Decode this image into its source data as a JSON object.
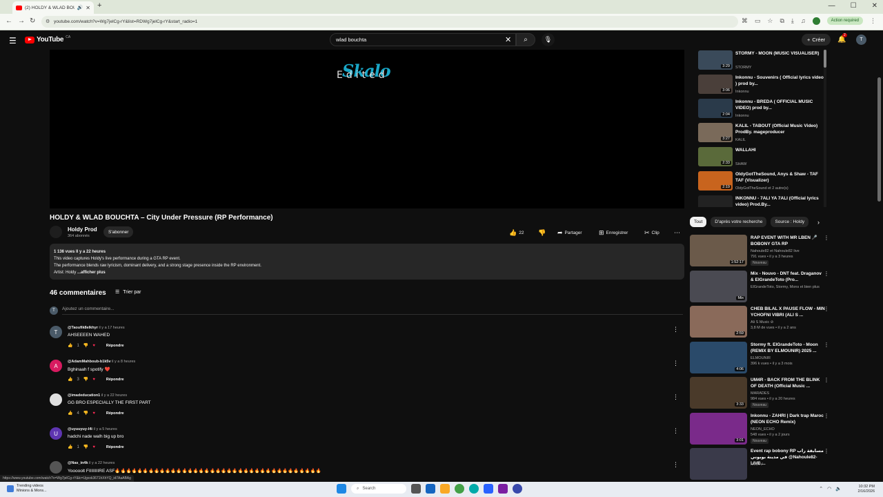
{
  "browser": {
    "tab_title": "(2) HOLDY & WLAD BOUCH...",
    "new_tab": "+",
    "url": "youtube.com/watch?v=Wg7jelCg-rY&list=RDWg7jelCg-rY&start_radio=1",
    "action_required": "Action required",
    "status_url": "https://www.youtube.com/watch?v=Wg7jelCg-rY&lc=Ugxxk3671hXhYQ_id7AaABAg"
  },
  "header": {
    "logo_text": "YouTube",
    "country_code": "CA",
    "search_value": "wlad bouchta",
    "create_label": "Créer",
    "notif_count": "2",
    "user_initial": "T"
  },
  "player": {
    "overlay_logo": "Skalo",
    "overlay_text": "Edited"
  },
  "video": {
    "title": "HOLDY & WLAD BOUCHTA – City Under Pressure (RP Performance)",
    "channel": "Holdy Prod",
    "subscribers": "364 abonnés",
    "subscribe_label": "S'abonner",
    "likes": "22",
    "share_label": "Partager",
    "save_label": "Enregistrer",
    "clip_label": "Clip"
  },
  "description": {
    "stats": "1 136 vues  Il y a 22 heures",
    "line1": "This video captures Holdy's live performance during a GTA RP event.",
    "line2": "The performance blends raw lyricism, dominant delivery, and a strong stage presence inside the RP environment.",
    "artist_prefix": "Artist: Holdy",
    "more": "...afficher plus"
  },
  "comments_section": {
    "count": "46 commentaires",
    "sort_label": "Trier par",
    "add_placeholder": "Ajoutez un commentaire...",
    "user_initial": "T",
    "reply_label": "Répondre",
    "items": [
      {
        "initial": "T",
        "color": "#4a5a68",
        "author": "@Taoufik8elkhyr",
        "time": "il y a 17 heures",
        "text": "AHSEEEEN WAHED",
        "likes": "1"
      },
      {
        "initial": "A",
        "color": "#d81b60",
        "author": "@AdamMahboub-b1k5v",
        "time": "il y a 8 heures",
        "text": "Bghinaah f spotify ❤️",
        "likes": "3"
      },
      {
        "initial": "",
        "color": "#e0e0e0",
        "author": "@imadeducation1",
        "time": "il y a 22 heures",
        "text": "GG BRO ESPECIALLY THE FIRST PART",
        "likes": "4"
      },
      {
        "initial": "U",
        "color": "#5e35b1",
        "author": "@uyuuyuy-l4i",
        "time": "il y a 5 heures",
        "text": "hadchi nade walh big up bro",
        "likes": "1"
      },
      {
        "initial": "",
        "color": "#555555",
        "author": "@Nas_in4k",
        "time": "il y a 22 heures",
        "text": "Yooooolt FIIIIIIIIRE ASF🔥🔥🔥🔥🔥🔥🔥🔥🔥🔥🔥🔥🔥🔥🔥🔥🔥🔥🔥🔥🔥🔥🔥🔥🔥🔥🔥🔥🔥🔥🔥🔥🔥🔥🔥🔥🔥",
        "likes": ""
      }
    ]
  },
  "playlist": [
    {
      "title": "STORMY - MOON (MUSIC VISUALISER)",
      "channel": "STORMY",
      "duration": "3:29",
      "color": "#3a4a5a"
    },
    {
      "title": "Inkonnu - Souvenirs ( Official lyrics video ) prod by...",
      "channel": "Inkonnu",
      "duration": "3:06",
      "color": "#4a3f3a"
    },
    {
      "title": "Inkonnu - BREDA ( OFFICIAL MUSIC VIDEO) prod by...",
      "channel": "Inkonnu",
      "duration": "2:04",
      "color": "#2a3a4a"
    },
    {
      "title": "KALIL - TABOUT (Official Music Video) ProdBy. mageproducer",
      "channel": "KALIL",
      "duration": "3:27",
      "color": "#7a6a5a"
    },
    {
      "title": "WALLAHI",
      "channel": "SHAW",
      "duration": "2:33",
      "color": "#5a6a3a"
    },
    {
      "title": "OldyGotTheSound, Anys & Shaw - TAF TAF (Visualizer)",
      "channel": "OldyGotTheSound et 2 autre(s)",
      "duration": "2:19",
      "color": "#c8641e"
    },
    {
      "title": "INKONNU - 7ALI YA 7ALI (Official lyrics video) Prod.By...",
      "channel": "Inkonnu",
      "duration": "2:46",
      "color": "#222222"
    }
  ],
  "chips": [
    "Tout",
    "D'après votre recherche",
    "Source : Holdy"
  ],
  "recommended": [
    {
      "title": "RAP EVENT WITH MR LBEN 🎤 BOBONY GTA RP",
      "meta1": "Nahoule82 et Nahoule82 live",
      "meta2": "791 vues • il y a 3 heures",
      "badge": "Nouveau",
      "duration": "1:52:17",
      "color": "#6b5a4a"
    },
    {
      "title": "Mix - Nouvo - DNT feat. Draganov & ElGrandeToto (Pro...",
      "meta1": "ElGrandeToto, Stormy, Mons et bien plus",
      "meta2": "",
      "badge": "",
      "duration": "Mix",
      "color": "#4a4a52"
    },
    {
      "title": "CHEB BILAL X PAUSE FLOW - MIN YCHOFNI VIBRI (ALI S ...",
      "meta1": "Ali S Music ⊘",
      "meta2": "3,8 M de vues • il y a 2 ans",
      "badge": "",
      "duration": "2:59",
      "color": "#8a6a5a"
    },
    {
      "title": "Stormy ft. ElGrandeToto - Moon (REMIX BY ELMOUNIR) 2025 ...",
      "meta1": "ELMOUNIR",
      "meta2": "396 k vues • il y a 3 mois",
      "badge": "",
      "duration": "4:06",
      "color": "#2a4a6a"
    },
    {
      "title": "UM4R - BACK FROM THE BLINK OF DEATH (Official Music ...",
      "meta1": "MARADES",
      "meta2": "984 vues • il y a 20 heures",
      "badge": "Nouveau",
      "duration": "3:33",
      "color": "#4a3a2a"
    },
    {
      "title": "Inkonnu - ZAHRI | Dark trap Maroc (NEON ECHO Remix)",
      "meta1": "NEON_ECHO",
      "meta2": "548 vues • il y a 2 jours",
      "badge": "Nouveau",
      "duration": "3:01",
      "color": "#7a2a8a"
    },
    {
      "title": "Event rap bobony RP مسابقة راب في مدينة بوبوني @Nahoule82-LIVE ...",
      "meta1": "MedTV",
      "meta2": "",
      "badge": "",
      "duration": "",
      "color": "#3a3a4a"
    }
  ],
  "taskbar": {
    "weather_title": "Trending videos",
    "weather_sub": "Minions & Mons...",
    "search_label": "Search",
    "time": "10:32 PM",
    "date": "2/16/2026"
  }
}
